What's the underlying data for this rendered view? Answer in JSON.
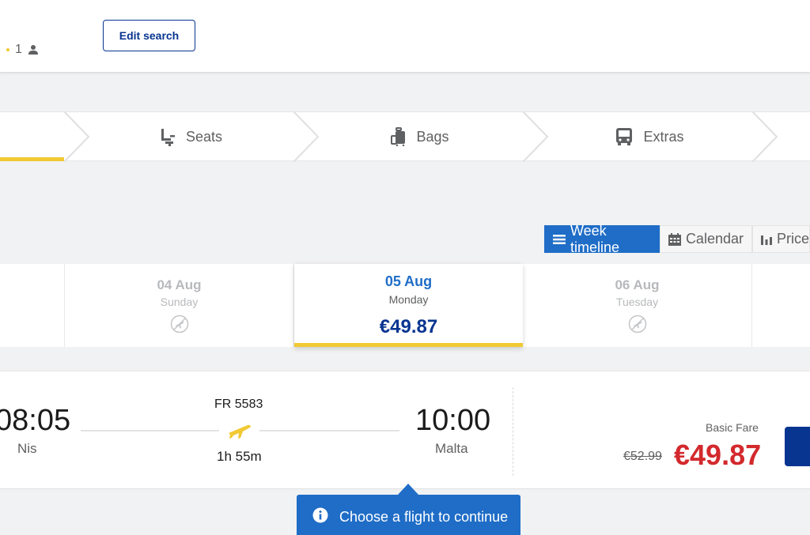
{
  "header": {
    "passenger_count": "1",
    "edit_search_label": "Edit search"
  },
  "steps": [
    {
      "label": "Seats",
      "icon": "seat-icon"
    },
    {
      "label": "Bags",
      "icon": "luggage-icon"
    },
    {
      "label": "Extras",
      "icon": "bus-icon"
    }
  ],
  "view_toggle": {
    "week_timeline": "Week timeline",
    "calendar": "Calendar",
    "prices": "Price"
  },
  "dates": [
    {
      "date": "04 Aug",
      "weekday": "Sunday",
      "status": "no-flights-icon"
    },
    {
      "date": "05 Aug",
      "weekday": "Monday",
      "price": "€49.87",
      "selected": true
    },
    {
      "date": "06 Aug",
      "weekday": "Tuesday",
      "status": "no-flights-icon"
    }
  ],
  "flight": {
    "departure_time": "08:05",
    "departure_city": "Nis",
    "flight_number": "FR 5583",
    "duration": "1h 55m",
    "arrival_time": "10:00",
    "arrival_city": "Malta",
    "fare_label": "Basic Fare",
    "old_price": "€52.99",
    "price": "€49.87"
  },
  "tooltip": {
    "text": "Choose a flight to continue"
  },
  "colors": {
    "brand_blue": "#073590",
    "accent_blue": "#1f6dc7",
    "yellow": "#f1c933",
    "price_red": "#d3292d"
  }
}
